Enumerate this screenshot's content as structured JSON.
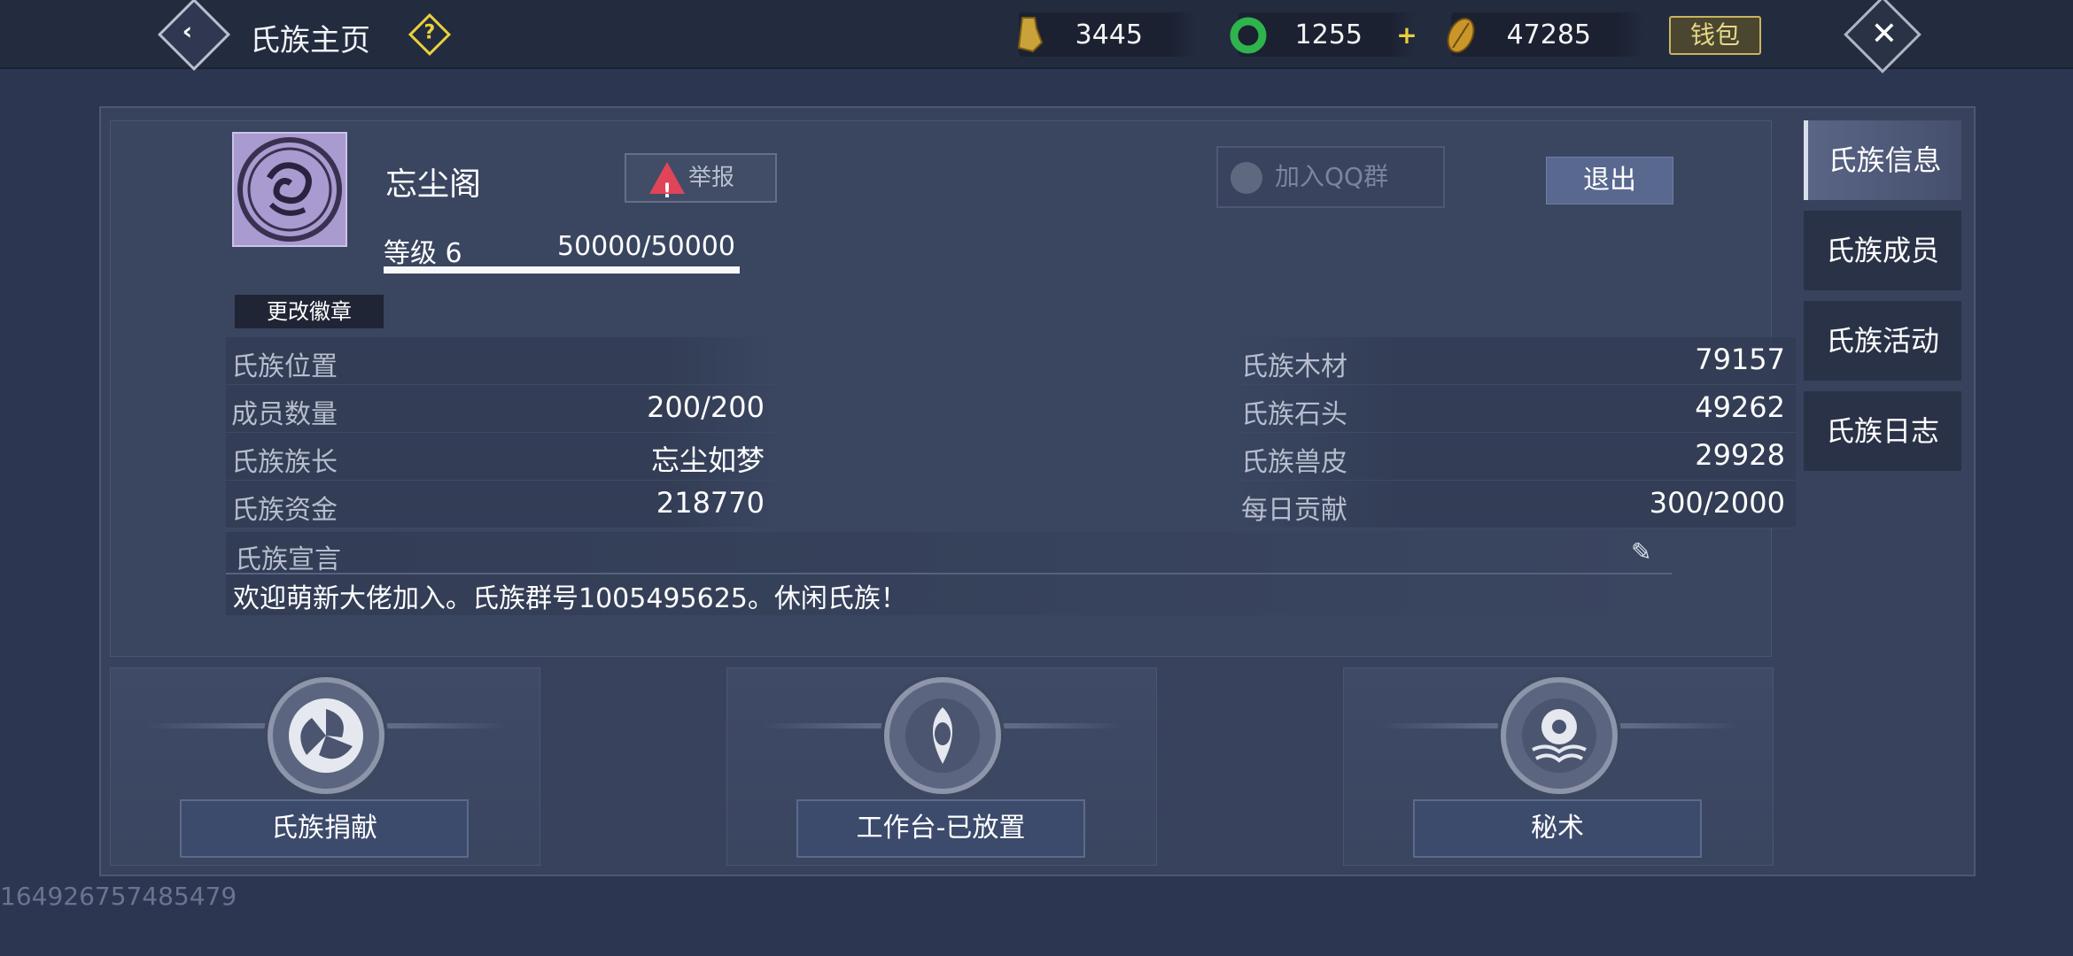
{
  "topbar": {
    "title": "氏族主页",
    "back_icon": "back-arrow-icon",
    "help_icon": "question-icon",
    "currencies": [
      {
        "name": "gold-bell-icon",
        "value": "3445",
        "color": "#c9a23a"
      },
      {
        "name": "jade-ring-icon",
        "value": "1255",
        "color": "#2fb34c"
      },
      {
        "name": "seed-icon",
        "value": "47285",
        "color": "#c9962a"
      }
    ],
    "wallet_label": "钱包"
  },
  "clan": {
    "name": "忘尘阁",
    "level_label": "等级 6",
    "exp": "50000/50000",
    "exp_fraction": 1.0,
    "change_emblem_label": "更改徽章",
    "report_label": "举报",
    "qq_label": "加入QQ群",
    "exit_label": "退出"
  },
  "stats_left": [
    {
      "label": "氏族位置",
      "value": ""
    },
    {
      "label": "成员数量",
      "value": "200/200"
    },
    {
      "label": "氏族族长",
      "value": "忘尘如梦"
    },
    {
      "label": "氏族资金",
      "value": "218770"
    }
  ],
  "stats_right": [
    {
      "label": "氏族木材",
      "value": "79157"
    },
    {
      "label": "氏族石头",
      "value": "49262"
    },
    {
      "label": "氏族兽皮",
      "value": "29928"
    },
    {
      "label": "每日贡献",
      "value": "300/2000"
    }
  ],
  "declaration": {
    "header": "氏族宣言",
    "text": "欢迎萌新大佬加入。氏族群号1005495625。休闲氏族！"
  },
  "cards": [
    {
      "icon": "donation-swirl-icon",
      "label": "氏族捐献"
    },
    {
      "icon": "workbench-icon",
      "label": "工作台-已放置"
    },
    {
      "icon": "secret-art-icon",
      "label": "秘术"
    }
  ],
  "side_tabs": [
    {
      "label": "氏族信息",
      "active": true
    },
    {
      "label": "氏族成员",
      "active": false
    },
    {
      "label": "氏族活动",
      "active": false
    },
    {
      "label": "氏族日志",
      "active": false
    }
  ],
  "footer_id": "164926757485479"
}
